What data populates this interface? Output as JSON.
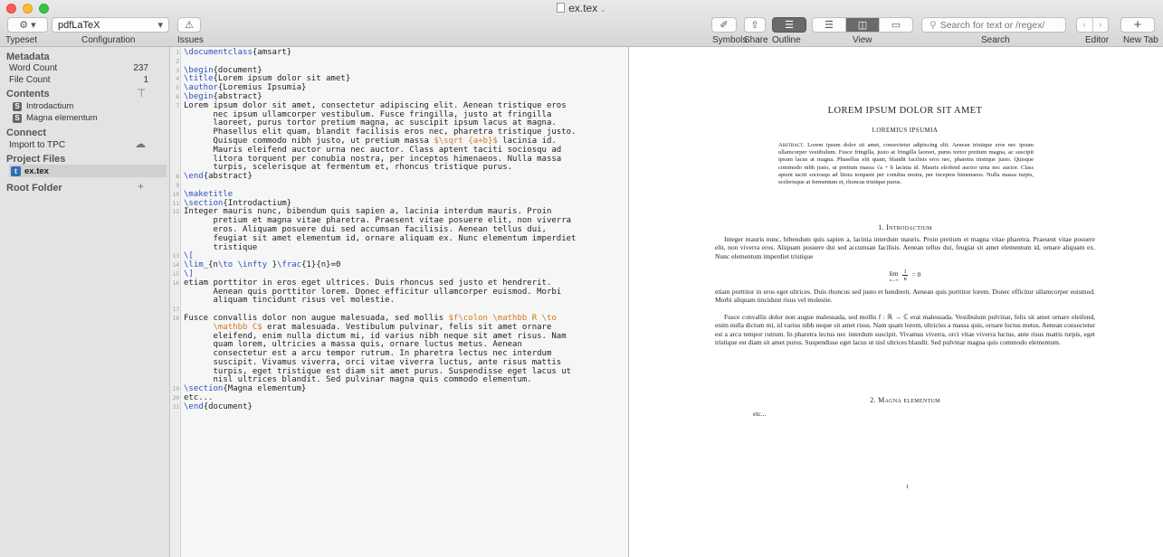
{
  "window": {
    "title": "ex.tex"
  },
  "toolbar": {
    "typeset_engine": "pdfLaTeX",
    "typeset_label": "Typeset",
    "configuration_label": "Configuration",
    "issues_label": "Issues",
    "symbols_label": "Symbols",
    "share_label": "Share",
    "outline_label": "Outline",
    "view_label": "View",
    "search_label": "Search",
    "search_placeholder": "Search for text or /regex/",
    "editor_label": "Editor",
    "newtab_label": "New Tab"
  },
  "sidebar": {
    "metadata_header": "Metadata",
    "metadata": [
      {
        "label": "Word Count",
        "value": "237"
      },
      {
        "label": "File Count",
        "value": "1"
      }
    ],
    "contents_header": "Contents",
    "contents": [
      {
        "label": "Introdactium"
      },
      {
        "label": "Magna elementum"
      }
    ],
    "connect_header": "Connect",
    "connect_item": "Import to TPC",
    "project_files_header": "Project Files",
    "project_file": "ex.tex",
    "root_folder_header": "Root Folder"
  },
  "editor": {
    "lines": [
      {
        "n": "1",
        "html": "<span class=\"kw\">\\documentclass</span>{amsart}"
      },
      {
        "n": "2",
        "html": ""
      },
      {
        "n": "3",
        "html": "<span class=\"kw\">\\begin</span>{document}"
      },
      {
        "n": "4",
        "html": "<span class=\"kw\">\\title</span>{Lorem ipsum dolor sit amet}"
      },
      {
        "n": "5",
        "html": "<span class=\"kw\">\\author</span>{Loremius Ipsumia}"
      },
      {
        "n": "6",
        "html": "<span class=\"kw\">\\begin</span>{abstract}"
      },
      {
        "n": "7",
        "html": "Lorem ipsum dolor sit amet, consectetur adipiscing elit. Aenean tristique eros\n      nec ipsum ullamcorper vestibulum. Fusce fringilla, justo at fringilla\n      laoreet, purus tortor pretium magna, ac suscipit ipsum lacus at magna.\n      Phasellus elit quam, blandit facilisis eros nec, pharetra tristique justo.\n      Quisque commodo nibh justo, ut pretium massa <span class=\"math\">$\\sqrt {a+b}$</span> lacinia id.\n      Mauris eleifend auctor urna nec auctor. Class aptent taciti sociosqu ad\n      litora torquent per conubia nostra, per inceptos himenaeos. Nulla massa\n      turpis, scelerisque at fermentum et, rhoncus tristique purus."
      },
      {
        "n": "8",
        "html": "<span class=\"kw\">\\end</span>{abstract}"
      },
      {
        "n": "9",
        "html": ""
      },
      {
        "n": "10",
        "html": "<span class=\"kw\">\\maketitle</span>"
      },
      {
        "n": "11",
        "html": "<span class=\"kw\">\\section</span>{Introdactium}"
      },
      {
        "n": "12",
        "html": "Integer mauris nunc, bibendum quis sapien a, lacinia interdum mauris. Proin\n      pretium et magna vitae pharetra. Praesent vitae posuere elit, non viverra\n      eros. Aliquam posuere dui sed accumsan facilisis. Aenean tellus dui,\n      feugiat sit amet elementum id, ornare aliquam ex. Nunc elementum imperdiet\n      tristique"
      },
      {
        "n": "13",
        "html": "<span class=\"kw\">\\[</span>"
      },
      {
        "n": "14",
        "html": "<span class=\"kw\">\\lim</span>_{n<span class=\"kw\">\\to</span> <span class=\"kw\">\\infty</span> }<span class=\"kw\">\\frac</span>{1}{n}=0"
      },
      {
        "n": "15",
        "html": "<span class=\"kw\">\\]</span>"
      },
      {
        "n": "16",
        "html": "etiam porttitor in eros eget ultrices. Duis rhoncus sed justo et hendrerit.\n      Aenean quis porttitor lorem. Donec efficitur ullamcorper euismod. Morbi\n      aliquam tincidunt risus vel molestie."
      },
      {
        "n": "17",
        "html": ""
      },
      {
        "n": "18",
        "html": "Fusce convallis dolor non augue malesuada, sed mollis <span class=\"math\">$f\\colon \\mathbb R \\to</span>\n      <span class=\"math\">\\mathbb C$</span> erat malesuada. Vestibulum pulvinar, felis sit amet ornare\n      eleifend, enim nulla dictum mi, id varius nibh neque sit amet risus. Nam\n      quam lorem, ultricies a massa quis, ornare luctus metus. Aenean\n      consectetur est a arcu tempor rutrum. In pharetra lectus nec interdum\n      suscipit. Vivamus viverra, orci vitae viverra luctus, ante risus mattis\n      turpis, eget tristique est diam sit amet purus. Suspendisse eget lacus ut\n      nisl ultrices blandit. Sed pulvinar magna quis commodo elementum."
      },
      {
        "n": "19",
        "html": "<span class=\"kw\">\\section</span>{Magna elementum}"
      },
      {
        "n": "20",
        "html": "etc..."
      },
      {
        "n": "21",
        "html": "<span class=\"kw\">\\end</span>{document}"
      }
    ]
  },
  "preview": {
    "title": "LOREM IPSUM DOLOR SIT AMET",
    "author": "LOREMIUS IPSUMIA",
    "abstract_label": "Abstract.",
    "abstract_text": "Lorem ipsum dolor sit amet, consectetur adipiscing elit. Aenean tristique eros nec ipsum ullamcorper vestibulum. Fusce fringilla, justo at fringilla laoreet, purus tortor pretium magna, ac suscipit ipsum lacus at magna. Phasellus elit quam, blandit facilisis eros nec, pharetra tristique justo. Quisque commodo nibh justo, ut pretium massa √a + b lacinia id. Mauris eleifend auctor urna nec auctor. Class aptent taciti sociosqu ad litora torquent per conubia nostra, per inceptos himenaeos. Nulla massa turpis, scelerisque at fermentum et, rhoncus tristique purus.",
    "section1": "1. Introdactium",
    "para1": "Integer mauris nunc, bibendum quis sapien a, lacinia interdum mauris. Proin pretium et magna vitae pharetra. Praesent vitae posuere elit, non viverra eros. Aliquam posuere dui sed accumsan facilisis. Aenean tellus dui, feugiat sit amet elementum id, ornare aliquam ex. Nunc elementum imperdiet tristique",
    "eq_lim": "lim",
    "eq_sub": "n→∞",
    "eq_num": "1",
    "eq_den": "n",
    "eq_rhs": "= 0",
    "para2": "etiam porttitor in eros eget ultrices. Duis rhoncus sed justo et hendrerit. Aenean quis porttitor lorem. Donec efficitur ullamcorper euismod. Morbi aliquam tincidunt risus vel molestie.",
    "para3": "Fusce convallis dolor non augue malesuada, sed mollis f : ℝ → ℂ erat malesuada. Vestibulum pulvinar, felis sit amet ornare eleifend, enim nulla dictum mi, id varius nibh neque sit amet risus. Nam quam lorem, ultricies a massa quis, ornare luctus metus. Aenean consectetur est a arcu tempor rutrum. In pharetra lectus nec interdum suscipit. Vivamus viverra, orci vitae viverra luctus, ante risus mattis turpis, eget tristique est diam sit amet purus. Suspendisse eget lacus ut nisl ultrices blandit. Sed pulvinar magna quis commodo elementum.",
    "section2": "2. Magna elementum",
    "etc": "etc...",
    "page_number": "1"
  },
  "icons": {
    "gear": "gear-icon",
    "issues": "warning-icon",
    "symbols": "pen-icon",
    "share": "share-icon",
    "outline": "list-icon",
    "search": "magnifier-icon",
    "connect": "cloud-upload-icon",
    "filter": "filter-icon",
    "add": "plus-icon"
  },
  "colors": {
    "keyword": "#2a52be",
    "math": "#d27a1b",
    "tex_file": "#2f6fb5"
  }
}
